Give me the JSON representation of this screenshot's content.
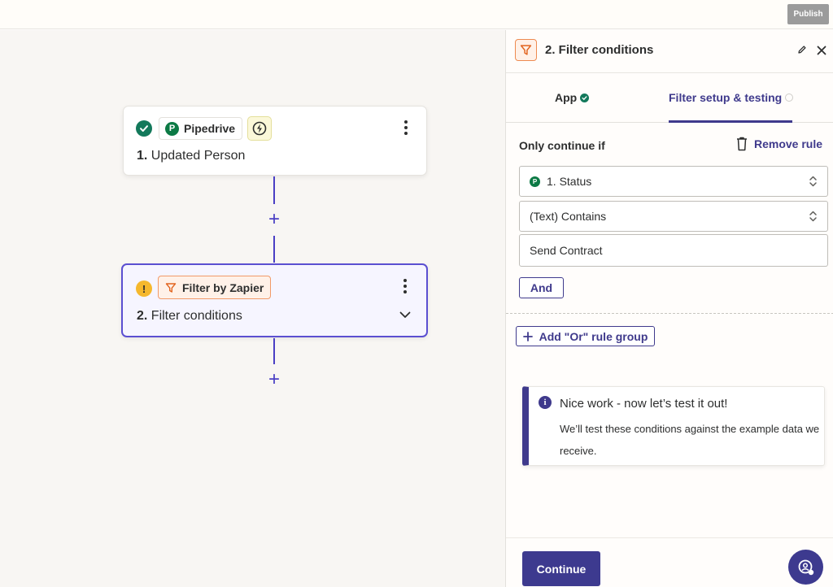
{
  "topbar": {
    "publish_label": "Publish"
  },
  "canvas": {
    "steps": [
      {
        "app_name": "Pipedrive",
        "app_logo_letter": "P",
        "number": "1.",
        "title": "Updated Person",
        "status": "complete"
      },
      {
        "app_name": "Filter by Zapier",
        "number": "2.",
        "title": "Filter conditions",
        "status": "warning",
        "status_glyph": "!"
      }
    ],
    "add_step_glyph": "+"
  },
  "panel": {
    "header": {
      "title": "2. Filter conditions"
    },
    "tabs": [
      {
        "label": "App",
        "state": "complete"
      },
      {
        "label": "Filter setup & testing",
        "state": "active"
      }
    ],
    "rule": {
      "heading": "Only continue if",
      "remove_label": "Remove rule",
      "field": {
        "logo_letter": "P",
        "value": "1. Status"
      },
      "condition": {
        "value": "(Text) Contains"
      },
      "value_input": {
        "value": "Send Contract"
      },
      "and_label": "And"
    },
    "or_group_label": "Add \"Or\" rule group",
    "info": {
      "glyph": "i",
      "title": "Nice work - now let’s test it out!",
      "body": "We’ll test these conditions against the example data we receive."
    },
    "footer": {
      "continue_label": "Continue"
    }
  },
  "colors": {
    "accent": "#3f3a8c",
    "success": "#13795b",
    "warning": "#f5b82e",
    "filter_orange": "#ee8a50",
    "pipedrive_green": "#0c7a45"
  }
}
